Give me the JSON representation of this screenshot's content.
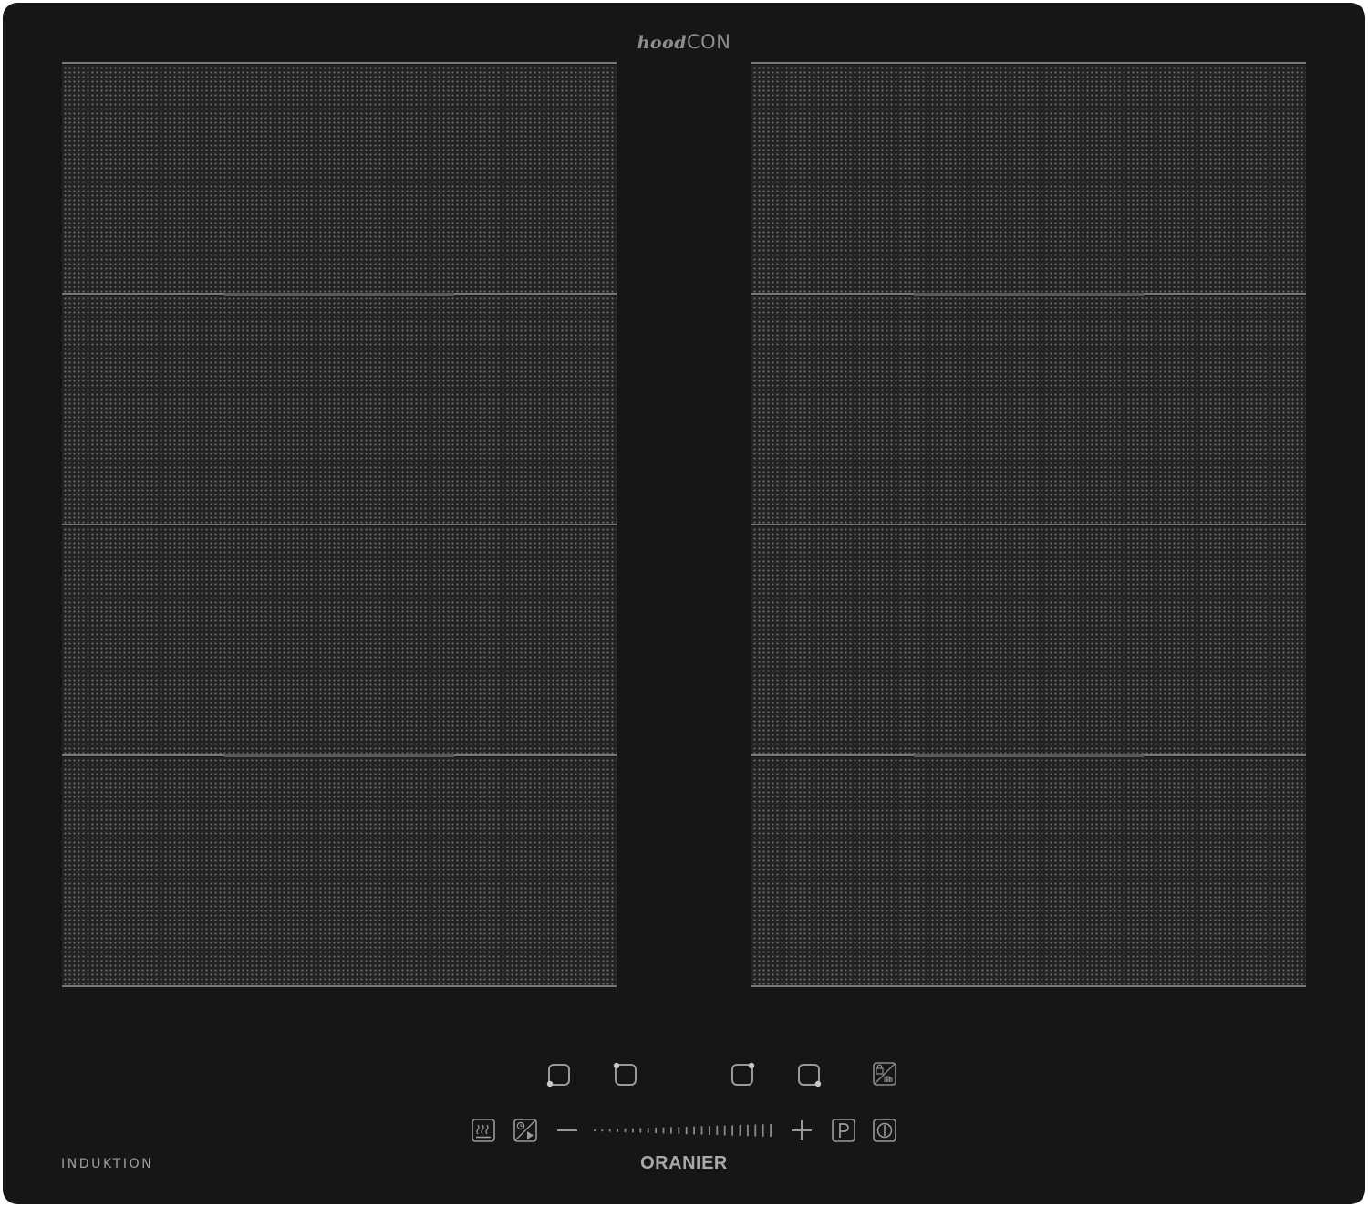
{
  "hob": {
    "top_brand_part1": "hood",
    "top_brand_part2": "CON",
    "type_label": "INDUKTION",
    "manufacturer": "ORANIER"
  },
  "zones": {
    "left_column_count": 4,
    "right_column_count": 4
  },
  "controls": {
    "zone_selectors": [
      "zone-front-left",
      "zone-rear-left",
      "zone-rear-right",
      "zone-front-right"
    ],
    "function_keys": [
      "keep-warm",
      "timer-auto",
      "minus",
      "power-slider",
      "plus",
      "power-boost",
      "on-off",
      "lock"
    ]
  },
  "colors": {
    "glass": "#161616",
    "zone_fill": "#232323",
    "dot": "#6e6e6e",
    "icon": "#9a9a9a"
  }
}
